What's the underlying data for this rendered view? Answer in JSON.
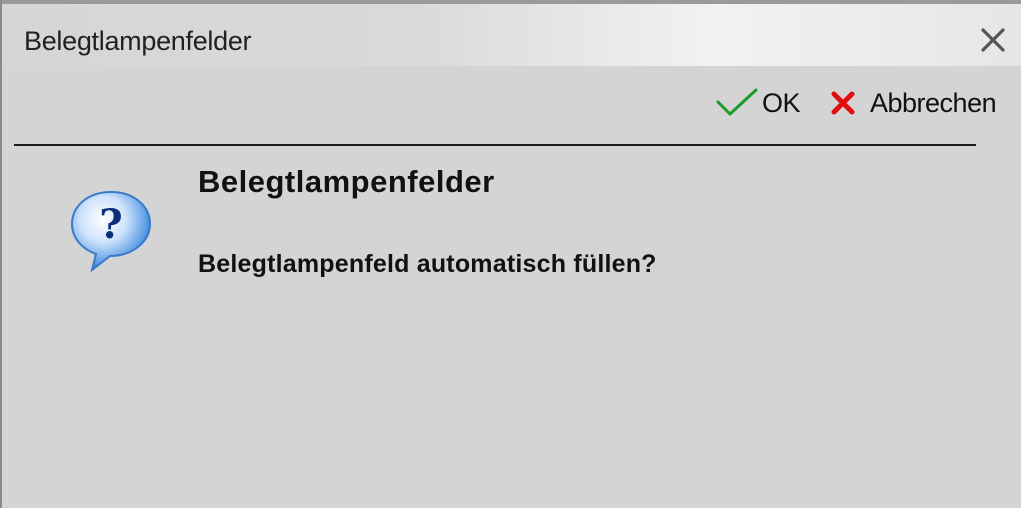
{
  "window": {
    "title": "Belegtlampenfelder"
  },
  "toolbar": {
    "ok_label": "OK",
    "cancel_label": "Abbrechen"
  },
  "message": {
    "heading": "Belegtlampenfelder",
    "text": "Belegtlampenfeld automatisch füllen?"
  },
  "icons": {
    "close": "close-icon",
    "ok": "checkmark-icon",
    "cancel": "red-x-icon",
    "question": "question-bubble-icon"
  },
  "colors": {
    "background": "#d4d4d4",
    "ok_check": "#1e9a2a",
    "cancel_x": "#e01010",
    "question_bubble": "#4a8fdc"
  }
}
